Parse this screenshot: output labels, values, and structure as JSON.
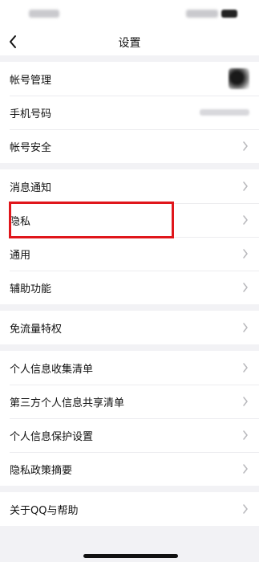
{
  "nav": {
    "title": "设置"
  },
  "groups": [
    {
      "items": [
        {
          "label": "帐号管理",
          "right": "avatar"
        },
        {
          "label": "手机号码",
          "right": "phone"
        },
        {
          "label": "帐号安全",
          "right": "chevron"
        }
      ]
    },
    {
      "items": [
        {
          "label": "消息通知",
          "right": "chevron"
        },
        {
          "label": "隐私",
          "right": "chevron",
          "highlighted": true
        },
        {
          "label": "通用",
          "right": "chevron"
        },
        {
          "label": "辅助功能",
          "right": "chevron"
        }
      ]
    },
    {
      "items": [
        {
          "label": "免流量特权",
          "right": "chevron"
        }
      ]
    },
    {
      "items": [
        {
          "label": "个人信息收集清单",
          "right": "chevron"
        },
        {
          "label": "第三方个人信息共享清单",
          "right": "chevron"
        },
        {
          "label": "个人信息保护设置",
          "right": "chevron"
        },
        {
          "label": "隐私政策摘要",
          "right": "chevron"
        }
      ]
    },
    {
      "items": [
        {
          "label": "关于QQ与帮助",
          "right": "chevron"
        }
      ]
    }
  ],
  "colors": {
    "highlight": "#e0161b",
    "chevron": "#b8b8bc",
    "background": "#f2f2f5"
  },
  "icons": {
    "back": "chevron-left-icon",
    "disclosure": "chevron-right-icon"
  }
}
